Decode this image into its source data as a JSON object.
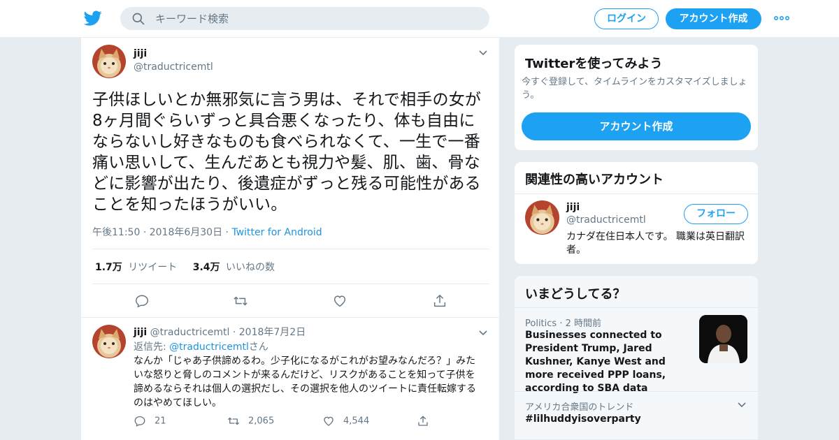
{
  "nav": {
    "search_placeholder": "キーワード検索",
    "login_label": "ログイン",
    "signup_label": "アカウント作成"
  },
  "colors": {
    "accent": "#1da1f2",
    "link": "#1b95e0",
    "muted": "#657786",
    "background": "#e6ecf0"
  },
  "tweet": {
    "name": "jiji",
    "handle": "@traductricemtl",
    "text": "子供ほしいとか無邪気に言う男は、それで相手の女が8ヶ月間ぐらいずっと具合悪くなったり、体も自由にならないし好きなものも食べられなくて、一生で一番痛い思いして、生んだあとも視力や髪、肌、歯、骨などに影響が出たり、後遺症がずっと残る可能性があることを知ったほうがいい。",
    "time": "午後11:50",
    "date": "2018年6月30日",
    "source": "Twitter for Android",
    "retweet_count": "1.7万",
    "retweet_label": "リツイート",
    "like_count": "3.4万",
    "like_label": "いいねの数"
  },
  "reply": {
    "name": "jiji",
    "handle": "@traductricemtl",
    "date": "2018年7月2日",
    "reply_to_label": "返信先:",
    "reply_to_handle": "@traductricemtl",
    "reply_to_suffix": "さん",
    "text": "なんか「じゃあ子供諦めるわ。少子化になるがこれがお望みなんだろ？」みたいな怒りと脅しのコメントが来るんだけど、リスクがあることを知って子供を諦めるならそれは個人の選択だし、その選択を他人のツイートに責任転嫁するのはやめてほしい。",
    "reply_count": "21",
    "retweet_count": "2,065",
    "like_count": "4,544"
  },
  "signup_card": {
    "title": "Twitterを使ってみよう",
    "subtitle": "今すぐ登録して、タイムラインをカスタマイズしましょう。",
    "button_label": "アカウント作成"
  },
  "related_card": {
    "title": "関連性の高いアカウント",
    "name": "jiji",
    "handle": "@traductricemtl",
    "bio": "カナダ在住日本人です。 職業は英日翻訳者。",
    "follow_label": "フォロー"
  },
  "trends_card": {
    "title": "いまどうしてる？",
    "news_category": "Politics",
    "news_time": "2 時間前",
    "news_headline": "Businesses connected to President Trump, Jared Kushner, Kanye West and more received PPP loans, according to SBA data",
    "trend_location": "アメリカ合衆国のトレンド",
    "trend_tag": "#lilhuddyisoverparty"
  }
}
